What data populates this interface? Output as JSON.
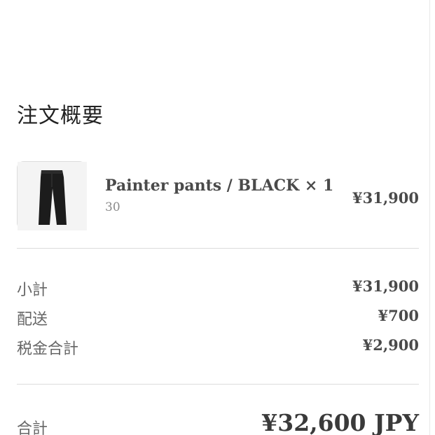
{
  "summary": {
    "title": "注文概要"
  },
  "item": {
    "thumbnail_icon": "black-pants-image",
    "name": "Painter pants / BLACK × 1",
    "variant": "30",
    "price": "¥31,900"
  },
  "totals": {
    "subtotal_label": "小計",
    "subtotal_value": "¥31,900",
    "shipping_label": "配送",
    "shipping_value": "¥700",
    "tax_label": "税金合計",
    "tax_value": "¥2,900",
    "total_label": "合計",
    "total_value": "¥32,600 JPY"
  },
  "colors": {
    "divider": "#dcdcdc",
    "text_primary": "#4a4a4a",
    "text_muted": "#8a8a8a"
  }
}
